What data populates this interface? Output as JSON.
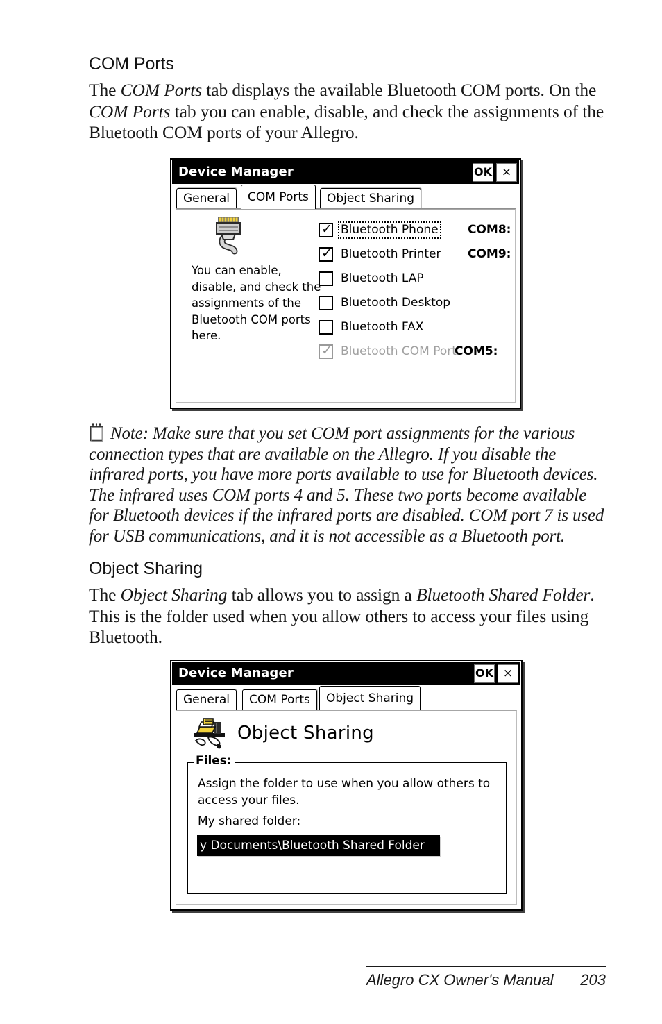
{
  "page": {
    "footer_title": "Allegro CX Owner's Manual",
    "page_number": "203"
  },
  "sections": {
    "com_ports": {
      "heading": "COM Ports",
      "paragraph_part1": "The ",
      "paragraph_em1": "COM Ports",
      "paragraph_part2": " tab displays the available Bluetooth COM ports. On the ",
      "paragraph_em2": "COM Ports",
      "paragraph_part3": " tab you can enable, disable, and check the assignments of the Bluetooth COM ports of your Allegro."
    },
    "note": {
      "icon": "notepad-icon",
      "text": "Note: Make sure that you set COM port assignments for the various connection types that are available on the Allegro. If you disable the infrared ports, you have more ports available to use for Bluetooth devices. The infrared uses COM ports 4 and 5. These two ports become available for Bluetooth devices if the infrared ports are disabled. COM port 7 is used for USB communications, and it is not accessible as a Bluetooth port."
    },
    "object_sharing": {
      "heading": "Object Sharing",
      "paragraph_part1": "The ",
      "paragraph_em1": "Object Sharing",
      "paragraph_part2": " tab allows you to assign a ",
      "paragraph_em2": "Bluetooth Shared Folder",
      "paragraph_part3": ". This is the folder used when you allow others to access your files using Bluetooth."
    }
  },
  "dialog_com_ports": {
    "title": "Device Manager",
    "ok_label": "OK",
    "close_label": "×",
    "tabs": [
      {
        "label": "General",
        "active": false
      },
      {
        "label": "COM Ports",
        "active": true
      },
      {
        "label": "Object Sharing",
        "active": false
      }
    ],
    "icon": "serial-cable-icon",
    "help_text": "You can enable, disable, and check the assignments of the Bluetooth COM ports here.",
    "ports": [
      {
        "label": "Bluetooth Phone",
        "checked": true,
        "disabled": false,
        "focused": true,
        "com": "COM8:"
      },
      {
        "label": "Bluetooth Printer",
        "checked": true,
        "disabled": false,
        "focused": false,
        "com": "COM9:"
      },
      {
        "label": "Bluetooth LAP",
        "checked": false,
        "disabled": false,
        "focused": false,
        "com": ""
      },
      {
        "label": "Bluetooth Desktop",
        "checked": false,
        "disabled": false,
        "focused": false,
        "com": ""
      },
      {
        "label": "Bluetooth FAX",
        "checked": false,
        "disabled": false,
        "focused": false,
        "com": ""
      },
      {
        "label": "Bluetooth COM Port",
        "checked": true,
        "disabled": true,
        "focused": false,
        "com": "COM5:"
      }
    ]
  },
  "dialog_object_sharing": {
    "title": "Device Manager",
    "ok_label": "OK",
    "close_label": "×",
    "tabs": [
      {
        "label": "General",
        "active": false
      },
      {
        "label": "COM Ports",
        "active": false
      },
      {
        "label": "Object Sharing",
        "active": true
      }
    ],
    "icon": "shared-folder-icon",
    "panel_title": "Object Sharing",
    "group_legend": "Files:",
    "group_text": "Assign the folder to use when you allow others to access your files.",
    "field_label": "My shared folder:",
    "field_value": "y Documents\\Bluetooth Shared Folder"
  }
}
